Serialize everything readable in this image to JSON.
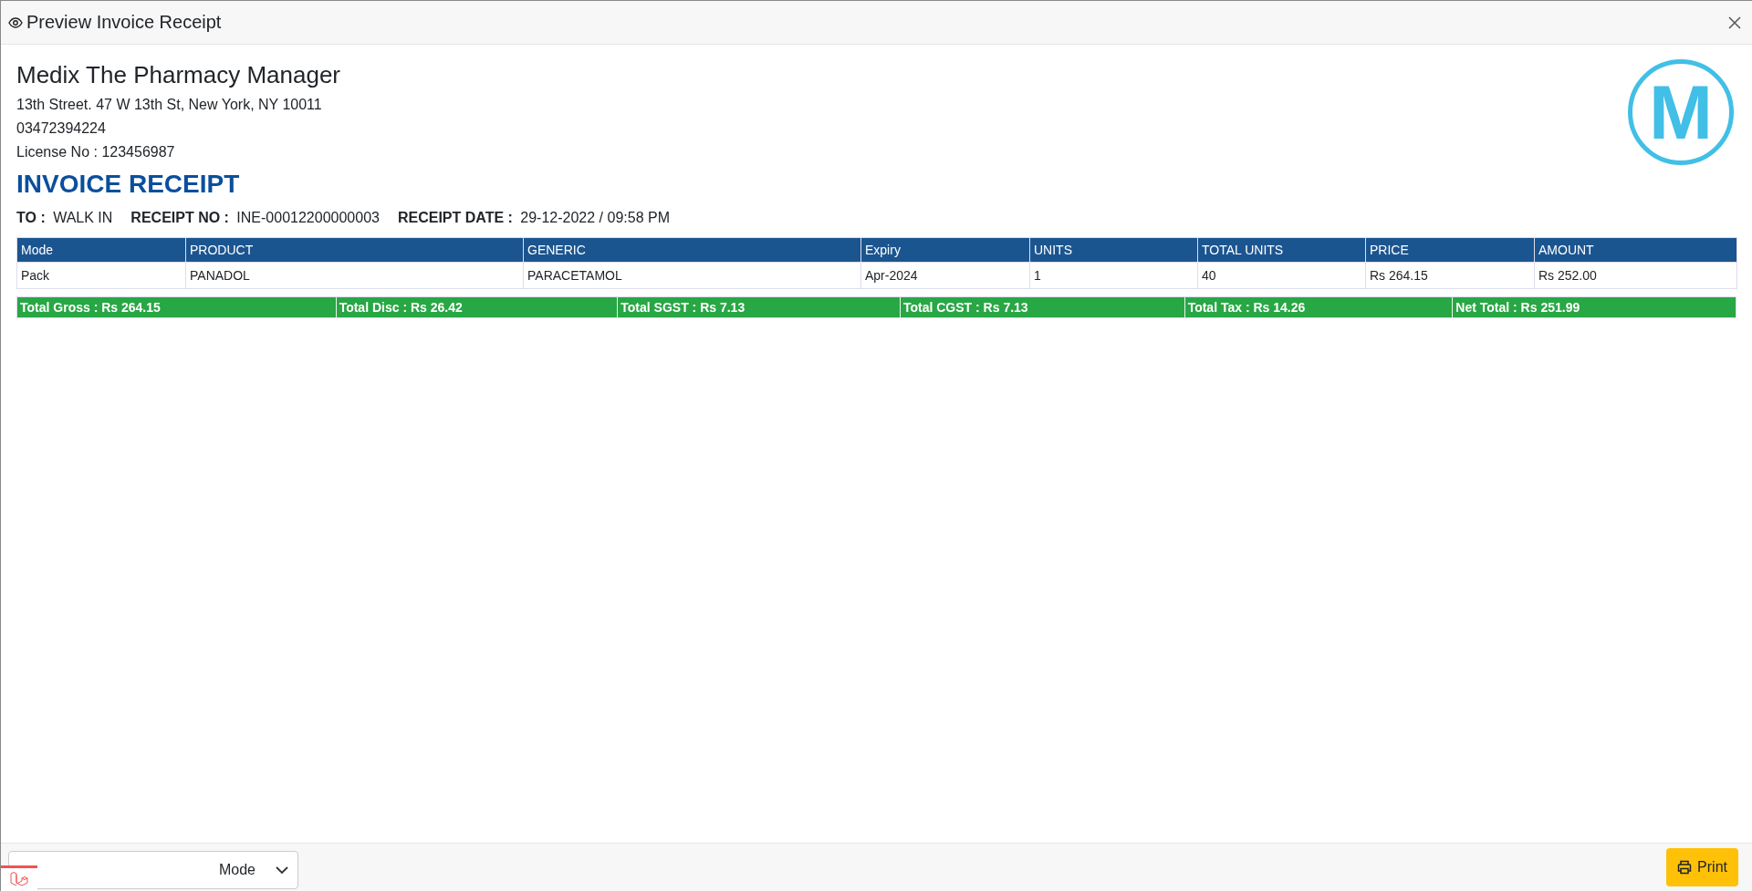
{
  "window": {
    "title": "Preview Invoice Receipt"
  },
  "company": {
    "name": "Medix The Pharmacy Manager",
    "address": "13th Street. 47 W 13th St, New York, NY 10011",
    "phone": "03472394224",
    "license": "License No : 123456987",
    "logo_letter": "M"
  },
  "invoice": {
    "heading": "INVOICE RECEIPT",
    "meta": [
      {
        "label": "TO :",
        "value": "WALK IN"
      },
      {
        "label": "RECEIPT NO :",
        "value": "INE-00012200000003"
      },
      {
        "label": "RECEIPT DATE :",
        "value": "29-12-2022 / 09:58 PM"
      }
    ]
  },
  "table": {
    "columns": [
      "Mode",
      "PRODUCT",
      "GENERIC",
      "Expiry",
      "UNITS",
      "TOTAL UNITS",
      "PRICE",
      "AMOUNT"
    ],
    "rows": [
      [
        "Pack",
        "PANADOL",
        "PARACETAMOL",
        "Apr-2024",
        "1",
        "40",
        "Rs 264.15",
        "Rs 252.00"
      ]
    ]
  },
  "totals": [
    "Total Gross : Rs 264.15",
    "Total Disc : Rs 26.42",
    "Total SGST : Rs 7.13",
    "Total CGST : Rs 7.13",
    "Total Tax : Rs 14.26",
    "Net Total : Rs 251.99"
  ],
  "footer": {
    "mode_select": {
      "value": "Mode"
    },
    "print_button": "Print"
  }
}
